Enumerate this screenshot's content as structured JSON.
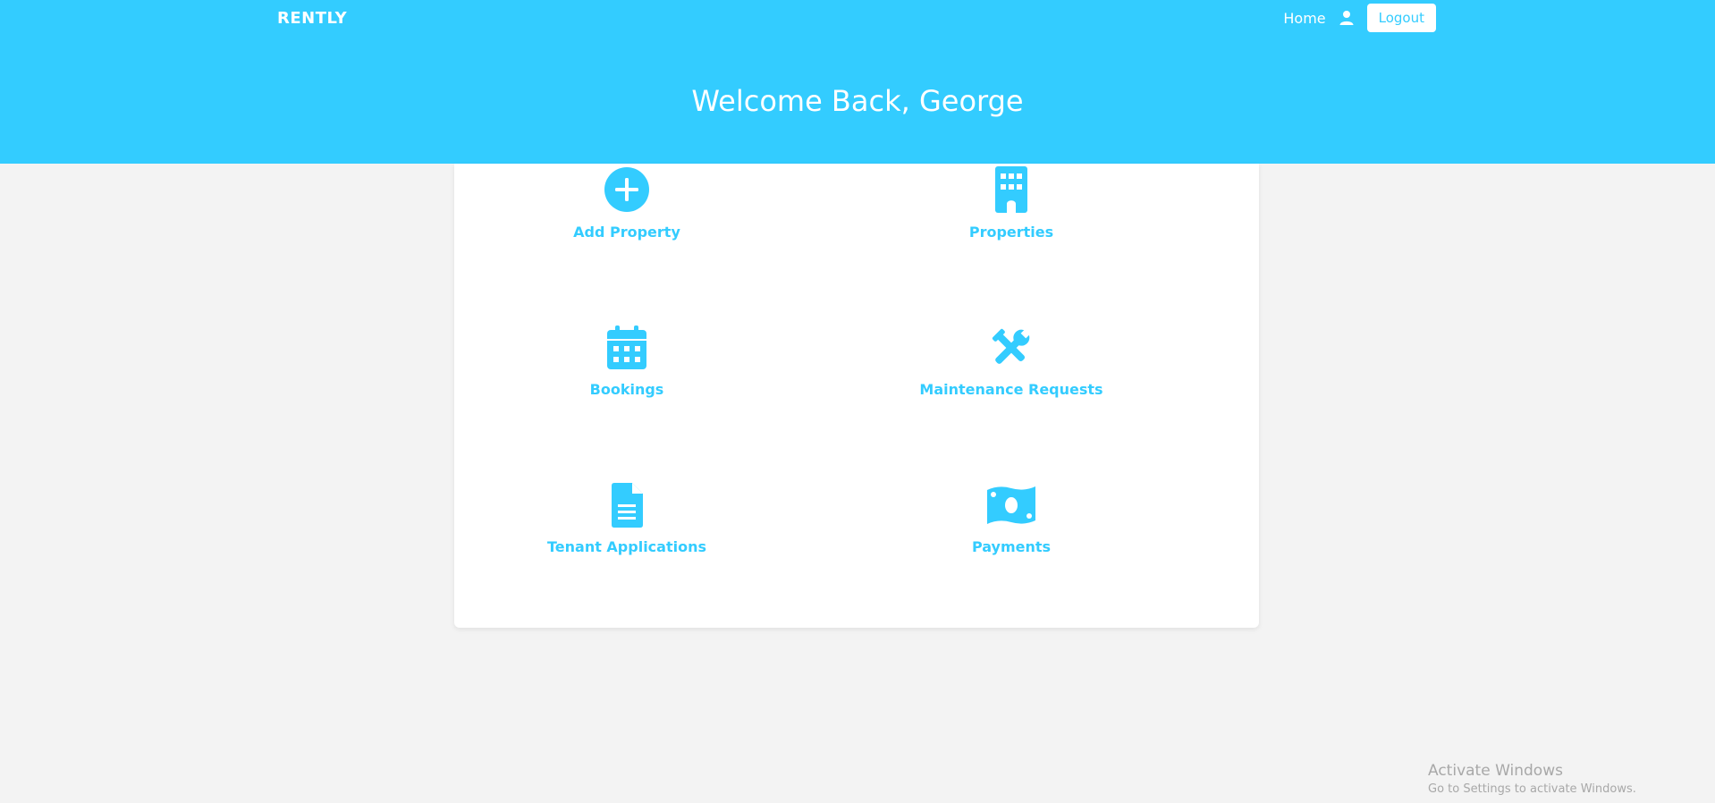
{
  "header": {
    "brand": "RENTLY",
    "nav": {
      "home_label": "Home",
      "logout_label": "Logout"
    },
    "welcome": "Welcome Back, George",
    "accent_color": "#33ccff"
  },
  "dashboard": {
    "tiles": [
      {
        "label": "Add Property",
        "icon": "plus-circle-icon"
      },
      {
        "label": "Properties",
        "icon": "building-icon"
      },
      {
        "label": "Bookings",
        "icon": "calendar-icon"
      },
      {
        "label": "Maintenance Requests",
        "icon": "tools-icon"
      },
      {
        "label": "Tenant Applications",
        "icon": "document-icon"
      },
      {
        "label": "Payments",
        "icon": "money-icon"
      }
    ]
  },
  "os_watermark": {
    "title": "Activate Windows",
    "subtitle": "Go to Settings to activate Windows."
  }
}
